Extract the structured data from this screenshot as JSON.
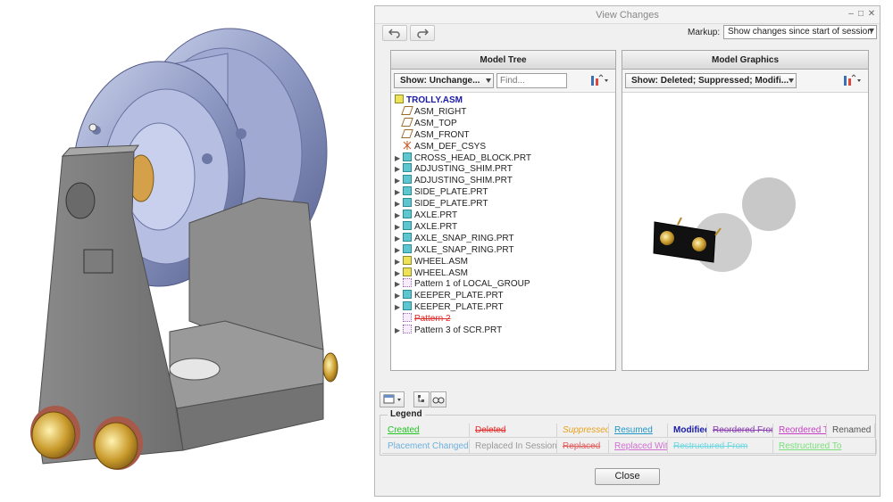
{
  "window": {
    "title": "View Changes",
    "minimize_glyph": "–",
    "maximize_glyph": "□",
    "close_glyph": "✕"
  },
  "toolbar": {
    "undo_icon": "undo-icon",
    "redo_icon": "redo-icon"
  },
  "markup": {
    "label": "Markup:",
    "value": "Show changes since start of session"
  },
  "model_tree": {
    "title": "Model Tree",
    "show_filter": "Show: Unchange...",
    "find_placeholder": "Find...",
    "items": [
      {
        "label": "TROLLY.ASM",
        "icon": "asm",
        "level": 0,
        "expand": false,
        "style": "root"
      },
      {
        "label": "ASM_RIGHT",
        "icon": "datum",
        "level": 1,
        "expand": false
      },
      {
        "label": "ASM_TOP",
        "icon": "datum",
        "level": 1,
        "expand": false
      },
      {
        "label": "ASM_FRONT",
        "icon": "datum",
        "level": 1,
        "expand": false
      },
      {
        "label": "ASM_DEF_CSYS",
        "icon": "csys",
        "level": 1,
        "expand": false
      },
      {
        "label": "CROSS_HEAD_BLOCK.PRT",
        "icon": "part",
        "level": 1,
        "expand": true
      },
      {
        "label": "ADJUSTING_SHIM.PRT",
        "icon": "part",
        "level": 1,
        "expand": true
      },
      {
        "label": "ADJUSTING_SHIM.PRT",
        "icon": "part",
        "level": 1,
        "expand": true
      },
      {
        "label": "SIDE_PLATE.PRT",
        "icon": "part",
        "level": 1,
        "expand": true
      },
      {
        "label": "SIDE_PLATE.PRT",
        "icon": "part",
        "level": 1,
        "expand": true
      },
      {
        "label": "AXLE.PRT",
        "icon": "part",
        "level": 1,
        "expand": true
      },
      {
        "label": "AXLE.PRT",
        "icon": "part",
        "level": 1,
        "expand": true
      },
      {
        "label": "AXLE_SNAP_RING.PRT",
        "icon": "part",
        "level": 1,
        "expand": true
      },
      {
        "label": "AXLE_SNAP_RING.PRT",
        "icon": "part",
        "level": 1,
        "expand": true
      },
      {
        "label": "WHEEL.ASM",
        "icon": "asm",
        "level": 1,
        "expand": true
      },
      {
        "label": "WHEEL.ASM",
        "icon": "asm",
        "level": 1,
        "expand": true
      },
      {
        "label": "Pattern 1 of LOCAL_GROUP",
        "icon": "pattern",
        "level": 1,
        "expand": true
      },
      {
        "label": "KEEPER_PLATE.PRT",
        "icon": "part",
        "level": 1,
        "expand": true
      },
      {
        "label": "KEEPER_PLATE.PRT",
        "icon": "part",
        "level": 1,
        "expand": true
      },
      {
        "label": "Pattern 2",
        "icon": "pattern",
        "level": 1,
        "expand": false,
        "style": "deleted"
      },
      {
        "label": "Pattern 3 of SCR.PRT",
        "icon": "pattern",
        "level": 1,
        "expand": true
      }
    ]
  },
  "model_graphics": {
    "title": "Model Graphics",
    "show_filter": "Show: Deleted; Suppressed; Modifi..."
  },
  "legend": {
    "title": "Legend",
    "row1": [
      {
        "label": "Created",
        "color": "#22c422",
        "style": "underline"
      },
      {
        "label": "Deleted",
        "color": "#e32b2b",
        "style": "strike"
      },
      {
        "label": "Suppressed",
        "color": "#e8a11a",
        "style": "italic"
      },
      {
        "label": "Resumed",
        "color": "#2196c4",
        "style": "underline"
      },
      {
        "label": "Modified",
        "color": "#1a1aa8",
        "style": "bold"
      },
      {
        "label": "Reordered From",
        "color": "#8a3fb0",
        "style": "strike"
      },
      {
        "label": "Reordered To",
        "color": "#c43fc4",
        "style": "underline"
      },
      {
        "label": "Renamed",
        "color": "#555555",
        "style": "plain"
      }
    ],
    "row2": [
      {
        "label": "Placement Changed",
        "color": "#6eb0dc",
        "style": "plain"
      },
      {
        "label": "Replaced In Session",
        "color": "#999999",
        "style": "plain"
      },
      {
        "label": "Replaced",
        "color": "#e06060",
        "style": "strike"
      },
      {
        "label": "Replaced With",
        "color": "#d070d0",
        "style": "underline"
      },
      {
        "label": "Restructured From",
        "color": "#6fd7e0",
        "style": "strike"
      },
      {
        "label": "Restructured To",
        "color": "#7be07b",
        "style": "underline"
      }
    ]
  },
  "close_label": "Close"
}
